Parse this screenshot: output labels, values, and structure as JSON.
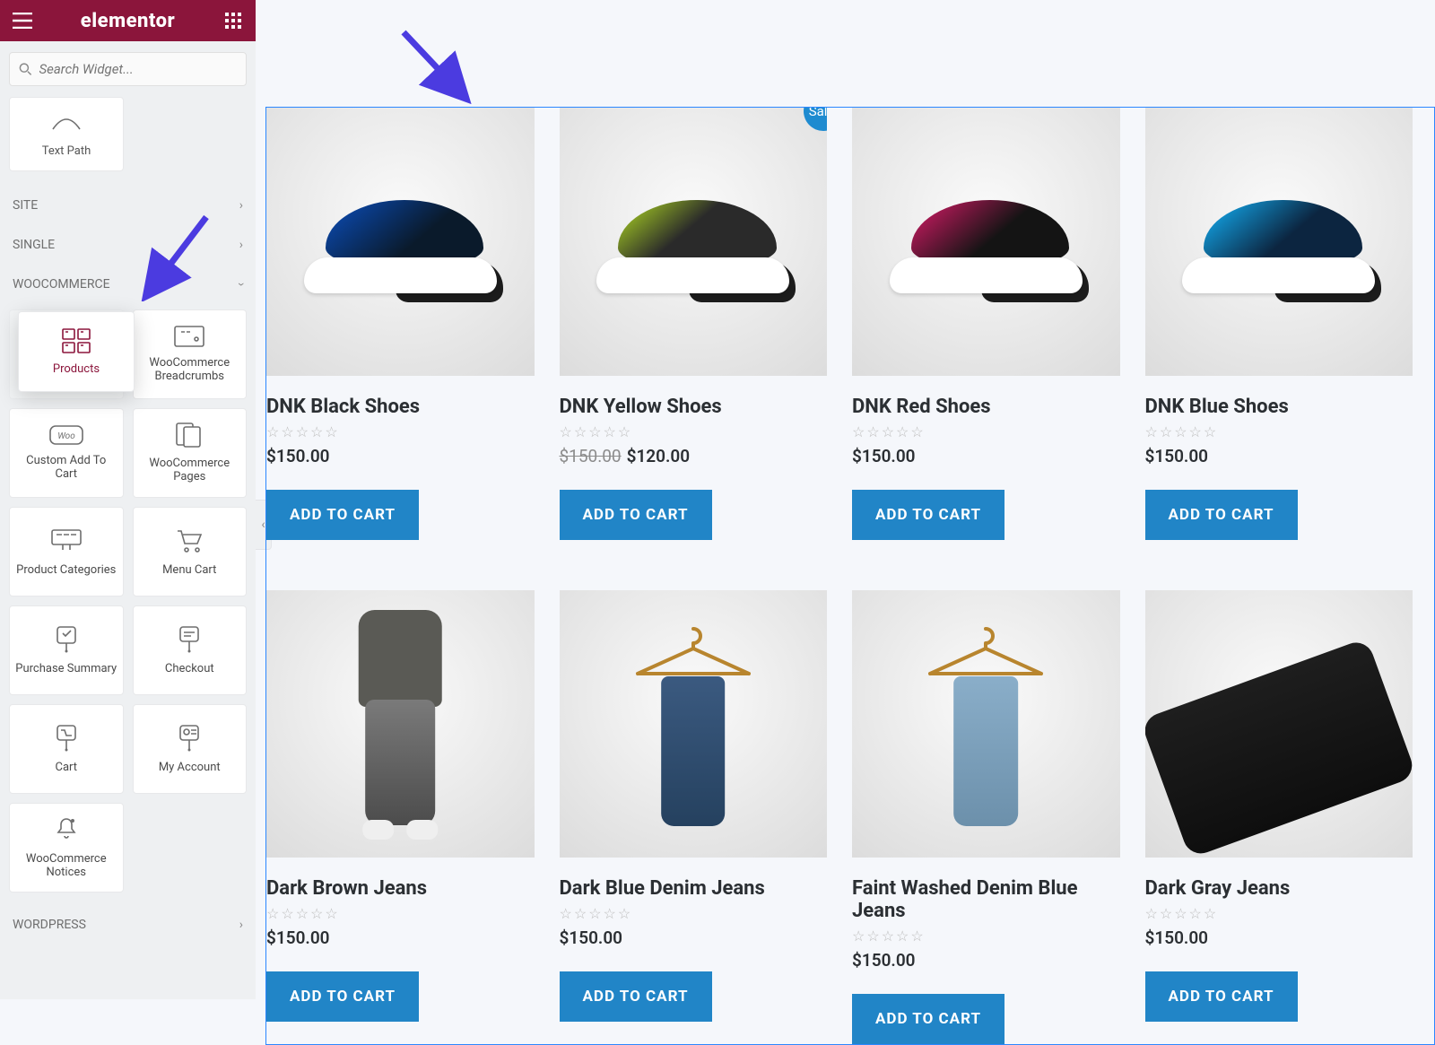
{
  "app": {
    "name": "elementor"
  },
  "search": {
    "placeholder": "Search Widget..."
  },
  "top_widget": {
    "label": "Text Path"
  },
  "categories": {
    "site": "SITE",
    "single": "SINGLE",
    "woocommerce": "WOOCOMMERCE",
    "wordpress": "WORDPRESS"
  },
  "woo_widgets": [
    {
      "label": "Products",
      "icon": "products"
    },
    {
      "label": "WooCommerce Breadcrumbs",
      "icon": "breadcrumbs"
    },
    {
      "label": "Custom Add To Cart",
      "icon": "woo-badge"
    },
    {
      "label": "WooCommerce Pages",
      "icon": "pages"
    },
    {
      "label": "Product Categories",
      "icon": "categories"
    },
    {
      "label": "Menu Cart",
      "icon": "cart"
    },
    {
      "label": "Purchase Summary",
      "icon": "summary"
    },
    {
      "label": "Checkout",
      "icon": "checkout"
    },
    {
      "label": "Cart",
      "icon": "cart-panel"
    },
    {
      "label": "My Account",
      "icon": "account"
    },
    {
      "label": "WooCommerce Notices",
      "icon": "notices"
    }
  ],
  "sale_label": "Sale!",
  "cart_label": "ADD TO CART",
  "products": [
    {
      "title": "DNK Black Shoes",
      "price": "$150.00",
      "variant": "blue"
    },
    {
      "title": "DNK Yellow Shoes",
      "price": "$120.00",
      "old_price": "$150.00",
      "sale": true,
      "variant": "yellow"
    },
    {
      "title": "DNK Red Shoes",
      "price": "$150.00",
      "variant": "red"
    },
    {
      "title": "DNK Blue Shoes",
      "price": "$150.00",
      "variant": "cyan"
    },
    {
      "title": "Dark Brown Jeans",
      "price": "$150.00",
      "variant": "person"
    },
    {
      "title": "Dark Blue Denim Jeans",
      "price": "$150.00",
      "variant": "hanger-dblue"
    },
    {
      "title": "Faint Washed Denim Blue Jeans",
      "price": "$150.00",
      "variant": "hanger-lblue"
    },
    {
      "title": "Dark Gray Jeans",
      "price": "$150.00",
      "variant": "darkfold"
    }
  ]
}
